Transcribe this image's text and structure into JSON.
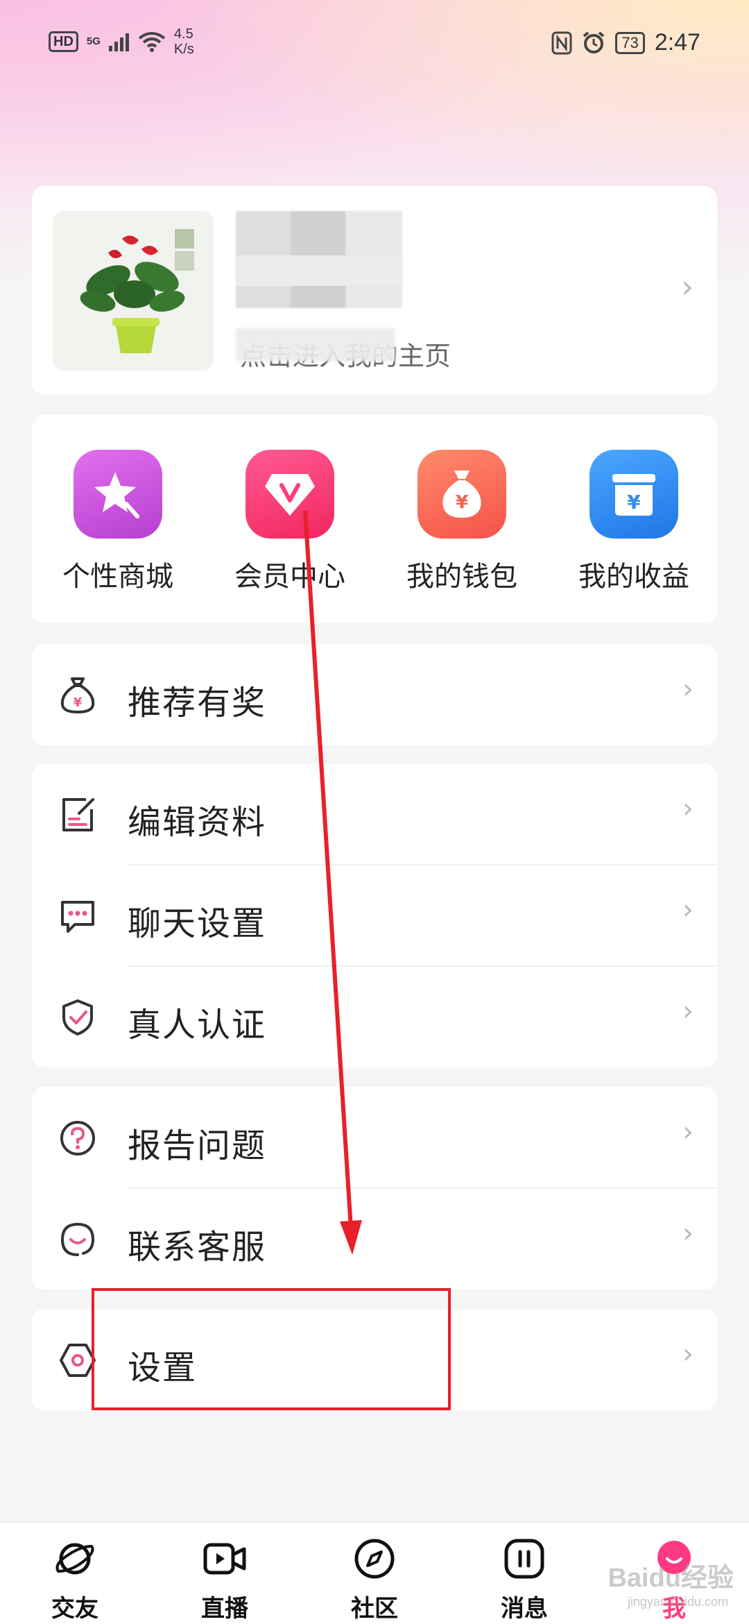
{
  "status_bar": {
    "hd": "HD",
    "network": "5G",
    "speed_value": "4.5",
    "speed_unit": "K/s",
    "battery": "73",
    "time": "2:47"
  },
  "profile": {
    "subtitle": "点击进入我的主页"
  },
  "features": [
    {
      "label": "个性商城",
      "icon": "star-wand-icon",
      "color": "#c84bdc"
    },
    {
      "label": "会员中心",
      "icon": "vip-diamond-icon",
      "color": "#ff3b7a"
    },
    {
      "label": "我的钱包",
      "icon": "money-bag-icon",
      "color": "#ff6b5a"
    },
    {
      "label": "我的收益",
      "icon": "earnings-box-icon",
      "color": "#2f8ff0"
    }
  ],
  "menu": {
    "group1": [
      {
        "label": "推荐有奖",
        "icon": "money-bag-outline-icon"
      }
    ],
    "group2": [
      {
        "label": "编辑资料",
        "icon": "edit-profile-icon"
      },
      {
        "label": "聊天设置",
        "icon": "chat-bubble-icon"
      },
      {
        "label": "真人认证",
        "icon": "shield-check-icon"
      }
    ],
    "group3": [
      {
        "label": "报告问题",
        "icon": "question-circle-icon"
      },
      {
        "label": "联系客服",
        "icon": "customer-service-icon"
      }
    ],
    "group4": [
      {
        "label": "设置",
        "icon": "settings-hexagon-icon"
      }
    ]
  },
  "bottom_nav": [
    {
      "label": "交友",
      "icon": "planet-icon",
      "active": false
    },
    {
      "label": "直播",
      "icon": "video-camera-icon",
      "active": false
    },
    {
      "label": "社区",
      "icon": "compass-icon",
      "active": false
    },
    {
      "label": "消息",
      "icon": "message-icon",
      "active": false
    },
    {
      "label": "我",
      "icon": "me-avatar-icon",
      "active": true
    }
  ],
  "watermark": {
    "brand": "Baidu经验",
    "url": "jingyan.baidu.com"
  },
  "colors": {
    "accent_pink": "#ff3a82",
    "annotation_red": "#e8202a",
    "icon_pink": "#e8578a"
  }
}
